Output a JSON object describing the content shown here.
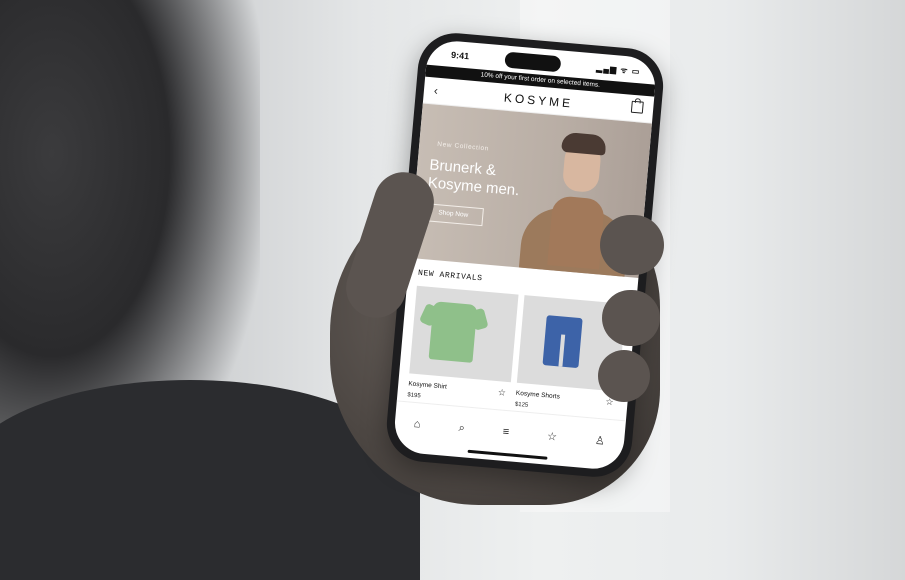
{
  "status": {
    "time": "9:41",
    "icons": "▂▄▆ ᯤ ▭"
  },
  "promo": {
    "text": "10% off your first order on selected items."
  },
  "nav": {
    "back": "‹",
    "brand": "KOSYME"
  },
  "hero": {
    "label": "New Collection",
    "title_line1": "Brunerk &",
    "title_line2": "Kosyme men.",
    "button": "Shop Now"
  },
  "section": {
    "title": "NEW ARRIVALS"
  },
  "products": [
    {
      "name": "Kosyme Shirt",
      "price": "$195",
      "color": "#8fc08a"
    },
    {
      "name": "Kosyme Shorts",
      "price": "$125",
      "color": "#3d63a8"
    }
  ],
  "tabs": {
    "home": "⌂",
    "search": "⌕",
    "menu": "≡",
    "favorites": "☆",
    "profile": "♙"
  },
  "icons": {
    "star": "☆"
  }
}
